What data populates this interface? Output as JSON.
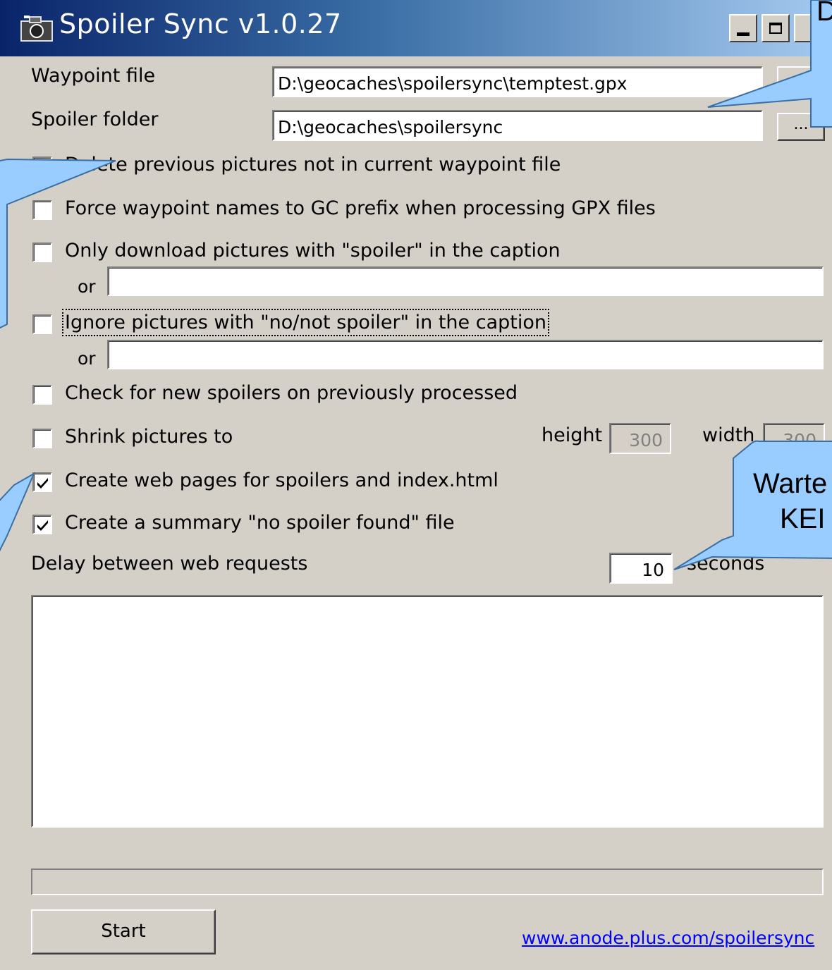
{
  "window": {
    "title": "Spoiler Sync v1.0.27",
    "icon": "camera-icon",
    "controls": [
      "minimize-icon",
      "maximize-icon"
    ]
  },
  "form": {
    "waypoint_label": "Waypoint file",
    "waypoint_value": "D:\\geocaches\\spoilersync\\temptest.gpx",
    "spoiler_label": "Spoiler folder",
    "spoiler_value": "D:\\geocaches\\spoilersync",
    "browse_label": "...",
    "options": [
      {
        "label": "Delete previous pictures not in current waypoint file",
        "checked": true
      },
      {
        "label": "Force waypoint names to GC prefix when processing GPX files",
        "checked": false
      },
      {
        "label": "Only download pictures with \"spoiler\" in the caption",
        "checked": false
      },
      {
        "label": "Ignore pictures with \"no/not spoiler\" in the caption",
        "checked": false
      },
      {
        "label": "Check for new spoilers on previously processed",
        "checked": false
      },
      {
        "label": "Shrink pictures to",
        "checked": false
      },
      {
        "label": "Create web pages for spoilers and index.html",
        "checked": true
      },
      {
        "label": "Create a summary \"no spoiler found\" file",
        "checked": true
      }
    ],
    "or_label": "or",
    "only_download_or_value": "",
    "ignore_or_value": "",
    "height_label": "height",
    "height_value": "300",
    "width_label": "width",
    "width_value": "300",
    "delay_label": "Delay between web requests",
    "delay_value": "10",
    "delay_unit": "seconds",
    "log_text": "",
    "progress": 0
  },
  "footer": {
    "start_label": "Start",
    "link_text": "www.anode.plus.com/spoilersync"
  },
  "callouts": {
    "top_right_text": "D",
    "right_text_line1": "Warte",
    "right_text_line2": "KEI"
  },
  "colors": {
    "dialog_bg": "#d4d0c8",
    "titlebar_start": "#0a246a",
    "titlebar_end": "#a6caf0",
    "callout_fill": "#99ccff",
    "callout_stroke": "#3a6ea5",
    "link": "#0000ff"
  }
}
